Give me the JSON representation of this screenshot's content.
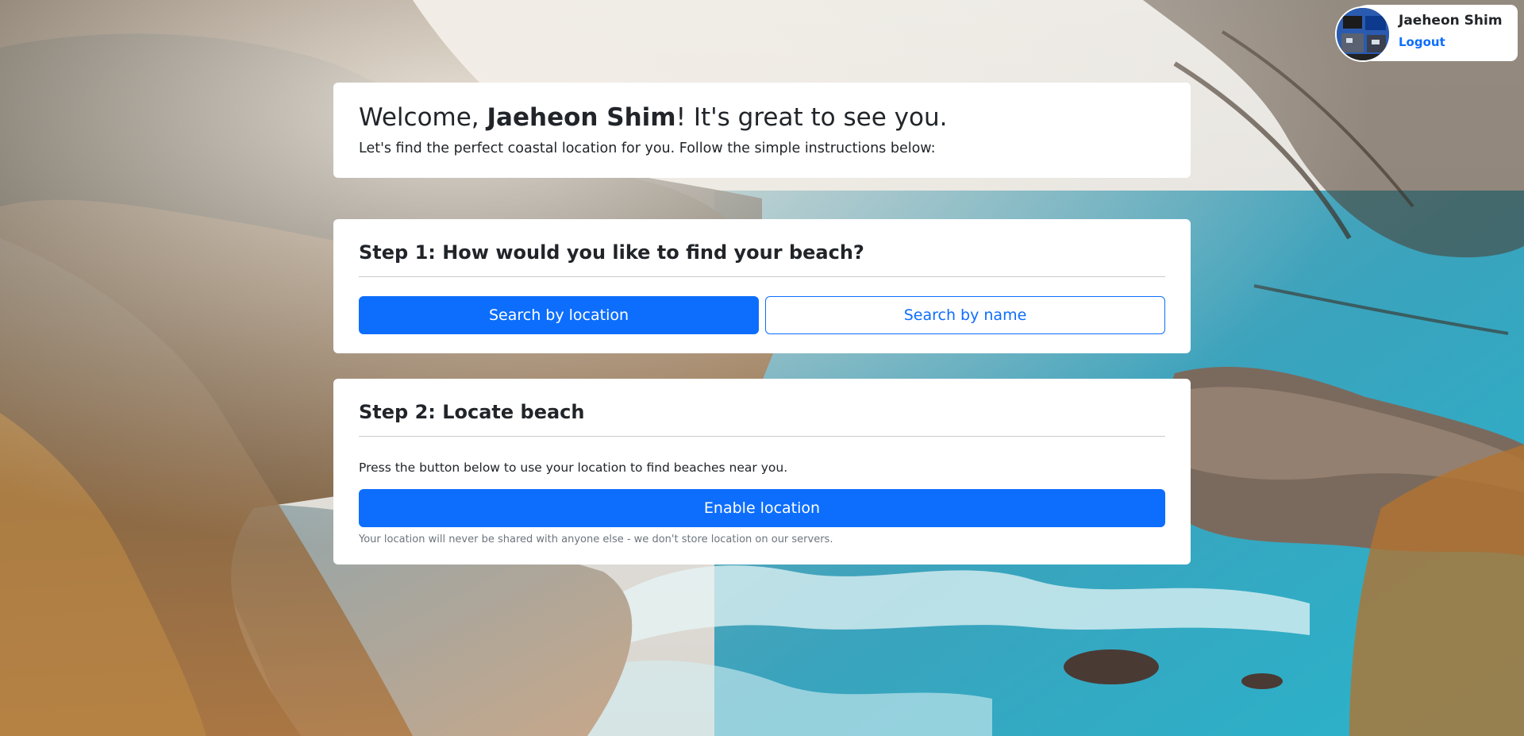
{
  "user": {
    "name": "Jaeheon Shim",
    "logout_label": "Logout"
  },
  "welcome": {
    "greeting_prefix": "Welcome, ",
    "name": "Jaeheon Shim",
    "greeting_suffix": "! It's great to see you.",
    "subtitle": "Let's find the perfect coastal location for you. Follow the simple instructions below:"
  },
  "step1": {
    "title": "Step 1: How would you like to find your beach?",
    "search_location_label": "Search by location",
    "search_name_label": "Search by name"
  },
  "step2": {
    "title": "Step 2: Locate beach",
    "description": "Press the button below to use your location to find beaches near you.",
    "enable_label": "Enable location",
    "note": "Your location will never be shared with anyone else - we don't store location on our servers."
  },
  "colors": {
    "primary": "#0d6efd",
    "card_bg": "#ffffff",
    "text": "#212529",
    "muted": "#6c757d"
  }
}
